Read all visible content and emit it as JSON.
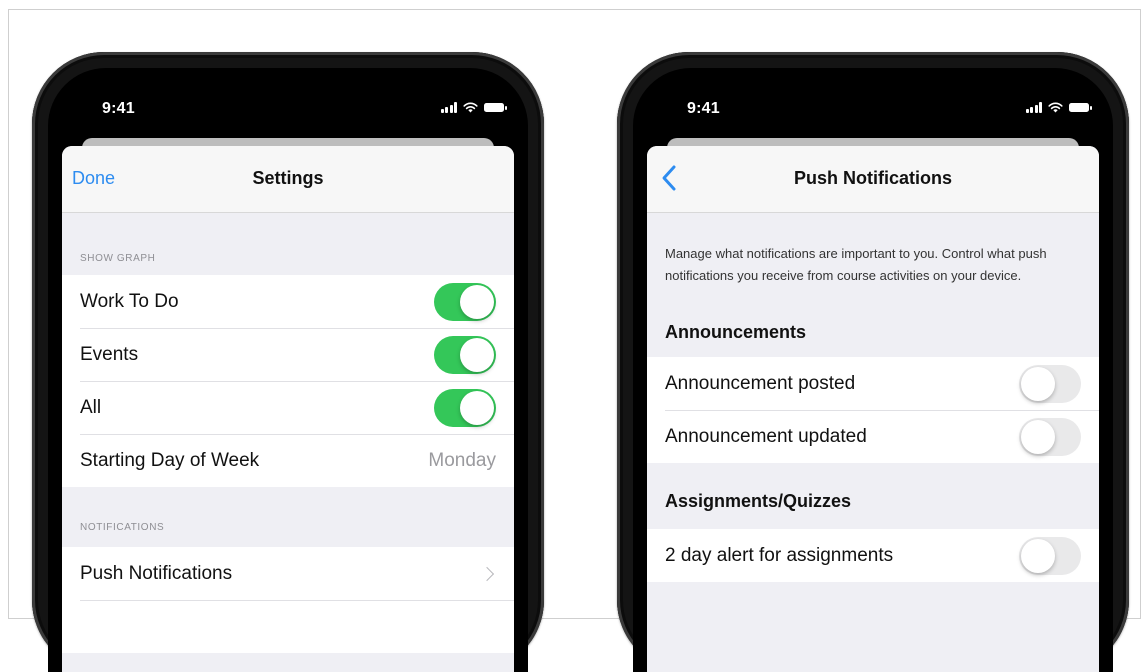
{
  "left_phone": {
    "status_time": "9:41",
    "nav": {
      "done_label": "Done",
      "title": "Settings"
    },
    "show_graph_header": "SHOW GRAPH",
    "rows": [
      {
        "label": "Work To Do",
        "toggle": "on"
      },
      {
        "label": "Events",
        "toggle": "on"
      },
      {
        "label": "All",
        "toggle": "on"
      }
    ],
    "starting_day": {
      "label": "Starting Day of Week",
      "value": "Monday"
    },
    "notifications_header": "NOTIFICATIONS",
    "push_row_label": "Push Notifications"
  },
  "right_phone": {
    "status_time": "9:41",
    "nav": {
      "title": "Push Notifications"
    },
    "intro": "Manage what notifications are important to you. Control what push notifications you receive from course activities on your device.",
    "announcements": {
      "title": "Announcements",
      "rows": [
        {
          "label": "Announcement posted",
          "toggle": "off"
        },
        {
          "label": "Announcement updated",
          "toggle": "off"
        }
      ]
    },
    "assignments": {
      "title": "Assignments/Quizzes",
      "rows": [
        {
          "label": "2 day alert for assignments",
          "toggle": "off"
        }
      ]
    }
  },
  "colors": {
    "accent": "#2d8cf0",
    "toggle_on": "#34c759",
    "toggle_off": "#e9e9ea",
    "grouped_background": "#efeff4"
  },
  "icons": [
    "wifi-icon",
    "cellular-signal-icon",
    "battery-icon",
    "back-chevron-icon",
    "chevron-right-icon"
  ]
}
